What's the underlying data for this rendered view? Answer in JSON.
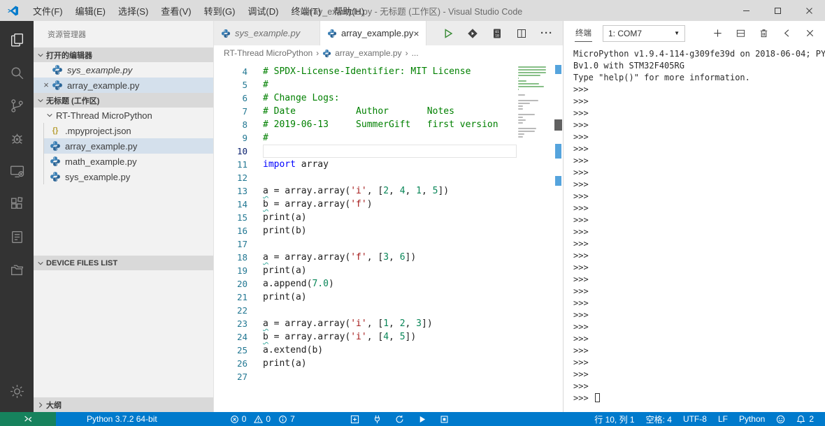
{
  "colors": {
    "status_bar": "#007acc",
    "remote_badge": "#16825d",
    "title_bar": "#dcdcdc",
    "activity_bar": "#333333",
    "comment": "#008000",
    "keyword": "#0000ff",
    "string": "#a31515",
    "number": "#098658",
    "selection_row": "#d4e0ec"
  },
  "window": {
    "title": "array_example.py - 无标题 (工作区) - Visual Studio Code",
    "menus": [
      "文件(F)",
      "编辑(E)",
      "选择(S)",
      "查看(V)",
      "转到(G)",
      "调试(D)",
      "终端(T)",
      "帮助(H)"
    ]
  },
  "activity_bar": {
    "top_icons": [
      {
        "name": "explorer",
        "active": true
      },
      {
        "name": "search",
        "active": false
      },
      {
        "name": "source-control",
        "active": false
      },
      {
        "name": "debug",
        "active": false
      },
      {
        "name": "remote-device",
        "active": false
      },
      {
        "name": "extensions",
        "active": false
      },
      {
        "name": "document-list",
        "active": false
      },
      {
        "name": "folder-projects",
        "active": false
      }
    ],
    "bottom_icons": [
      {
        "name": "settings-gear",
        "active": false
      }
    ]
  },
  "sidebar": {
    "title": "资源管理器",
    "open_editors": {
      "label": "打开的编辑器",
      "items": [
        {
          "name": "sys_example.py",
          "preview": true,
          "selected": false,
          "close": false
        },
        {
          "name": "array_example.py",
          "preview": false,
          "selected": true,
          "close": true
        }
      ]
    },
    "workspace": {
      "label": "无标题 (工作区)",
      "folder": "RT-Thread MicroPython",
      "files": [
        {
          "name": ".mpyproject.json",
          "icon": "json",
          "selected": false
        },
        {
          "name": "array_example.py",
          "icon": "python",
          "selected": true
        },
        {
          "name": "math_example.py",
          "icon": "python",
          "selected": false
        },
        {
          "name": "sys_example.py",
          "icon": "python",
          "selected": false
        }
      ]
    },
    "device_files": {
      "label": "DEVICE FILES LIST"
    },
    "outline": {
      "label": "大纲"
    }
  },
  "editor": {
    "tabs": [
      {
        "label": "sys_example.py",
        "active": false,
        "preview": true,
        "close": false
      },
      {
        "label": "array_example.py",
        "active": true,
        "preview": false,
        "close": true
      }
    ],
    "actions": [
      "run",
      "flash",
      "binary-file",
      "split-editor",
      "more"
    ],
    "breadcrumb": [
      "RT-Thread MicroPython",
      "array_example.py",
      "..."
    ],
    "current_line": 10,
    "minimap_leading_comment_lines": 3,
    "lines": [
      {
        "n": 4,
        "toks": [
          [
            "cm",
            "# SPDX-License-Identifier: MIT License"
          ]
        ]
      },
      {
        "n": 5,
        "toks": [
          [
            "cm",
            "#"
          ]
        ]
      },
      {
        "n": 6,
        "toks": [
          [
            "cm",
            "# Change Logs:"
          ]
        ]
      },
      {
        "n": 7,
        "toks": [
          [
            "cm",
            "# Date           Author       Notes"
          ]
        ]
      },
      {
        "n": 8,
        "toks": [
          [
            "cm",
            "# 2019-06-13     SummerGift   first version"
          ]
        ]
      },
      {
        "n": 9,
        "toks": [
          [
            "cm",
            "#"
          ]
        ]
      },
      {
        "n": 10,
        "toks": []
      },
      {
        "n": 11,
        "toks": [
          [
            "kw",
            "import"
          ],
          [
            "pl",
            " array"
          ]
        ]
      },
      {
        "n": 12,
        "toks": []
      },
      {
        "n": 13,
        "toks": [
          [
            "vu",
            "a"
          ],
          [
            "pl",
            " = array.array("
          ],
          [
            "st",
            "'i'"
          ],
          [
            "pl",
            ", ["
          ],
          [
            "nu",
            "2"
          ],
          [
            "pl",
            ", "
          ],
          [
            "nu",
            "4"
          ],
          [
            "pl",
            ", "
          ],
          [
            "nu",
            "1"
          ],
          [
            "pl",
            ", "
          ],
          [
            "nu",
            "5"
          ],
          [
            "pl",
            "])"
          ]
        ]
      },
      {
        "n": 14,
        "toks": [
          [
            "vu",
            "b"
          ],
          [
            "pl",
            " = array.array("
          ],
          [
            "st",
            "'f'"
          ],
          [
            "pl",
            ")"
          ]
        ]
      },
      {
        "n": 15,
        "toks": [
          [
            "pl",
            "print(a)"
          ]
        ]
      },
      {
        "n": 16,
        "toks": [
          [
            "pl",
            "print(b)"
          ]
        ]
      },
      {
        "n": 17,
        "toks": []
      },
      {
        "n": 18,
        "toks": [
          [
            "vu",
            "a"
          ],
          [
            "pl",
            " = array.array("
          ],
          [
            "st",
            "'f'"
          ],
          [
            "pl",
            ", ["
          ],
          [
            "nu",
            "3"
          ],
          [
            "pl",
            ", "
          ],
          [
            "nu",
            "6"
          ],
          [
            "pl",
            "])"
          ]
        ]
      },
      {
        "n": 19,
        "toks": [
          [
            "pl",
            "print(a)"
          ]
        ]
      },
      {
        "n": 20,
        "toks": [
          [
            "pl",
            "a.append("
          ],
          [
            "nu",
            "7.0"
          ],
          [
            "pl",
            ")"
          ]
        ]
      },
      {
        "n": 21,
        "toks": [
          [
            "pl",
            "print(a)"
          ]
        ]
      },
      {
        "n": 22,
        "toks": []
      },
      {
        "n": 23,
        "toks": [
          [
            "vu",
            "a"
          ],
          [
            "pl",
            " = array.array("
          ],
          [
            "st",
            "'i'"
          ],
          [
            "pl",
            ", ["
          ],
          [
            "nu",
            "1"
          ],
          [
            "pl",
            ", "
          ],
          [
            "nu",
            "2"
          ],
          [
            "pl",
            ", "
          ],
          [
            "nu",
            "3"
          ],
          [
            "pl",
            "])"
          ]
        ]
      },
      {
        "n": 24,
        "toks": [
          [
            "vu",
            "b"
          ],
          [
            "pl",
            " = array.array("
          ],
          [
            "st",
            "'i'"
          ],
          [
            "pl",
            ", ["
          ],
          [
            "nu",
            "4"
          ],
          [
            "pl",
            ", "
          ],
          [
            "nu",
            "5"
          ],
          [
            "pl",
            "])"
          ]
        ]
      },
      {
        "n": 25,
        "toks": [
          [
            "pl",
            "a.extend(b)"
          ]
        ]
      },
      {
        "n": 26,
        "toks": [
          [
            "pl",
            "print(a)"
          ]
        ]
      },
      {
        "n": 27,
        "toks": []
      }
    ]
  },
  "terminal": {
    "tab_label": "终端",
    "dropdown_value": "1: COM7",
    "banner": [
      "MicroPython v1.9.4-114-g309fe39d on 2018-06-04; PY",
      "Bv1.0 with STM32F405RG",
      "Type \"help()\" for more information."
    ],
    "prompt": ">>>",
    "prompt_repeat": 26,
    "final_prompt": ">>> "
  },
  "status_bar": {
    "interpreter": "Python 3.7.2 64-bit",
    "problems": {
      "errors": "0",
      "warnings": "0",
      "infos": "7"
    },
    "tool_icons": [
      "add-device",
      "plug",
      "sync",
      "run",
      "stop"
    ],
    "right_items": [
      "行 10, 列 1",
      "空格: 4",
      "UTF-8",
      "LF",
      "Python"
    ],
    "notifications_count": "2"
  }
}
